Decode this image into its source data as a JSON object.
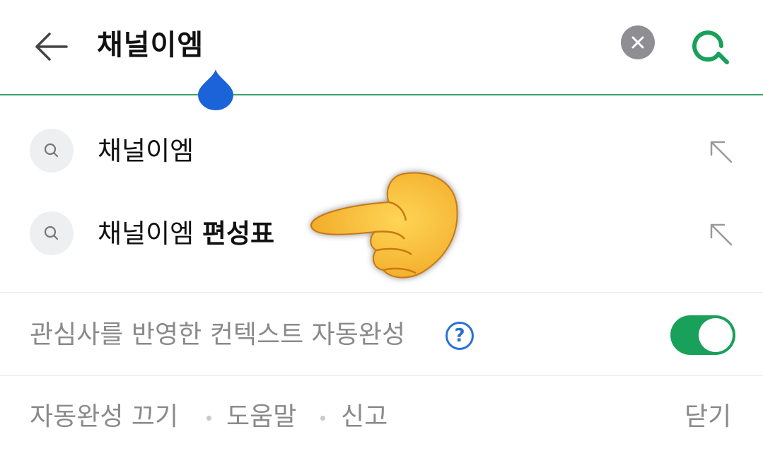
{
  "search": {
    "query": "채널이엠"
  },
  "suggestions": [
    {
      "prefix": "채널이엠",
      "highlight": ""
    },
    {
      "prefix": "채널이엠 ",
      "highlight": "편성표"
    }
  ],
  "context_autocomplete": {
    "label": "관심사를 반영한 컨텍스트 자동완성",
    "help": "?",
    "enabled": true
  },
  "footer": {
    "turn_off": "자동완성 끄기",
    "help": "도움말",
    "report": "신고",
    "close": "닫기"
  },
  "colors": {
    "accent_green": "#19a05a",
    "divider_green": "#35a46a",
    "help_blue": "#2a6fd6",
    "cursor_blue": "#1a63d8"
  }
}
